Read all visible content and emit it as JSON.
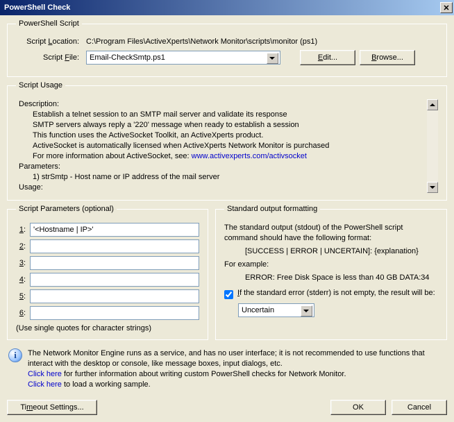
{
  "title": "PowerShell Check",
  "script_section": {
    "legend": "PowerShell Script",
    "location_label": "Script Location:",
    "location_value": "C:\\Program Files\\ActiveXperts\\Network Monitor\\scripts\\monitor (ps1)",
    "file_label": "Script File:",
    "file_value": "Email-CheckSmtp.ps1",
    "edit_btn": "Edit...",
    "browse_btn": "Browse..."
  },
  "usage_section": {
    "legend": "Script Usage",
    "description_label": "Description:",
    "d1": "Establish a telnet session to an SMTP mail server and validate its response",
    "d2": "SMTP servers always reply a '220' message when ready to establish a session",
    "d3": "This function uses the ActiveSocket Toolkit, an ActiveXperts product.",
    "d4": "ActiveSocket is automatically licensed when ActiveXperts Network Monitor is purchased",
    "d5_pre": "For more information about ActiveSocket, see: ",
    "d5_link": "www.activexperts.com/activsocket",
    "params_label": "Parameters:",
    "p1": "1) strSmtp - Host name or IP address of the mail server",
    "usage_label": "Usage:"
  },
  "params_section": {
    "legend": "Script Parameters (optional)",
    "labels": [
      "1:",
      "2:",
      "3:",
      "4:",
      "5:",
      "6:"
    ],
    "values": [
      "'<Hostname | IP>'",
      "",
      "",
      "",
      "",
      ""
    ],
    "hint": "(Use single quotes for character strings)"
  },
  "output_section": {
    "legend": "Standard output formatting",
    "line1": "The standard output (stdout) of the PowerShell script command should have the following format:",
    "format": "[SUCCESS | ERROR | UNCERTAIN]: {explanation}",
    "example_label": "For example:",
    "example": "ERROR: Free Disk Space is less than 40 GB DATA:34",
    "stderr_label": "If the standard error (stderr) is not empty, the result will be:",
    "stderr_value": "Uncertain"
  },
  "info": {
    "line1": "The Network Monitor Engine runs as a service, and has no user interface; it is not recommended to use functions that interact with the desktop or console, like message boxes, input dialogs, etc.",
    "link1_pre": "Click here",
    "link1_post": " for further information about writing custom PowerShell checks for Network Monitor.",
    "link2_pre": "Click here",
    "link2_post": " to load a working sample."
  },
  "buttons": {
    "timeout": "Timeout Settings...",
    "ok": "OK",
    "cancel": "Cancel"
  }
}
